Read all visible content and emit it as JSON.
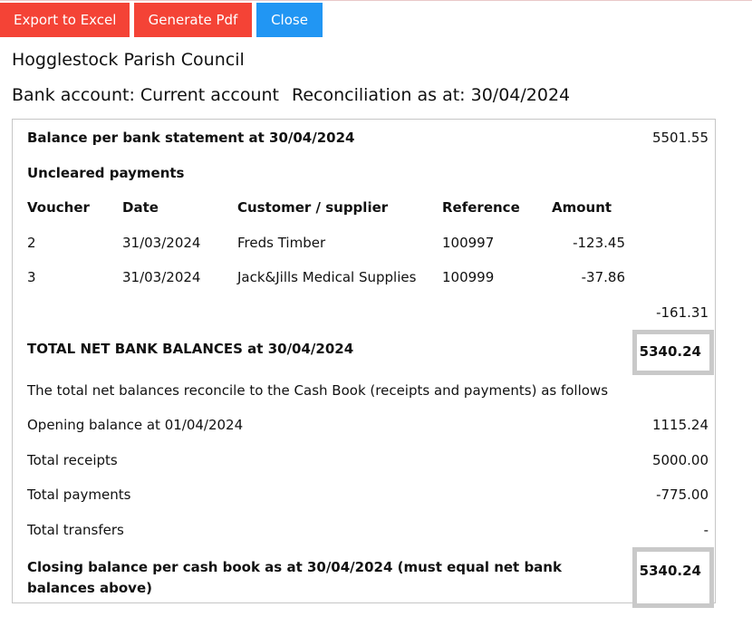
{
  "toolbar": {
    "export_excel": "Export to Excel",
    "generate_pdf": "Generate Pdf",
    "close": "Close"
  },
  "colors": {
    "primary_red": "#f44336",
    "primary_blue": "#2196f3",
    "highlight_border": "#c9c9c9"
  },
  "council_name": "Hogglestock Parish Council",
  "bank_account": "Bank account: Current account",
  "reconciliation_date": "Reconciliation as at: 30/04/2024",
  "report": {
    "balance_label": "Balance per bank statement at 30/04/2024",
    "balance_value": "5501.55",
    "uncleared_heading": "Uncleared payments",
    "columns": {
      "voucher": "Voucher",
      "date": "Date",
      "party": "Customer / supplier",
      "reference": "Reference",
      "amount": "Amount"
    },
    "rows": [
      {
        "voucher": "2",
        "date": "31/03/2024",
        "party": "Freds Timber",
        "reference": "100997",
        "amount": "-123.45"
      },
      {
        "voucher": "3",
        "date": "31/03/2024",
        "party": "Jack&Jills Medical Supplies",
        "reference": "100999",
        "amount": "-37.86"
      }
    ],
    "uncleared_total": "-161.31",
    "net_label": "TOTAL NET BANK BALANCES at 30/04/2024",
    "net_value": "5340.24",
    "reconcile_note": "The total net balances reconcile to the Cash Book (receipts and payments) as follows",
    "opening_label": "Opening balance at 01/04/2024",
    "opening_value": "1115.24",
    "receipts_label": "Total receipts",
    "receipts_value": "5000.00",
    "payments_label": "Total payments",
    "payments_value": "-775.00",
    "transfers_label": "Total transfers",
    "transfers_value": "-",
    "closing_label_line1": "Closing balance per cash book as at 30/04/2024 (must equal net bank",
    "closing_label_line2": "balances above)",
    "closing_value": "5340.24"
  }
}
